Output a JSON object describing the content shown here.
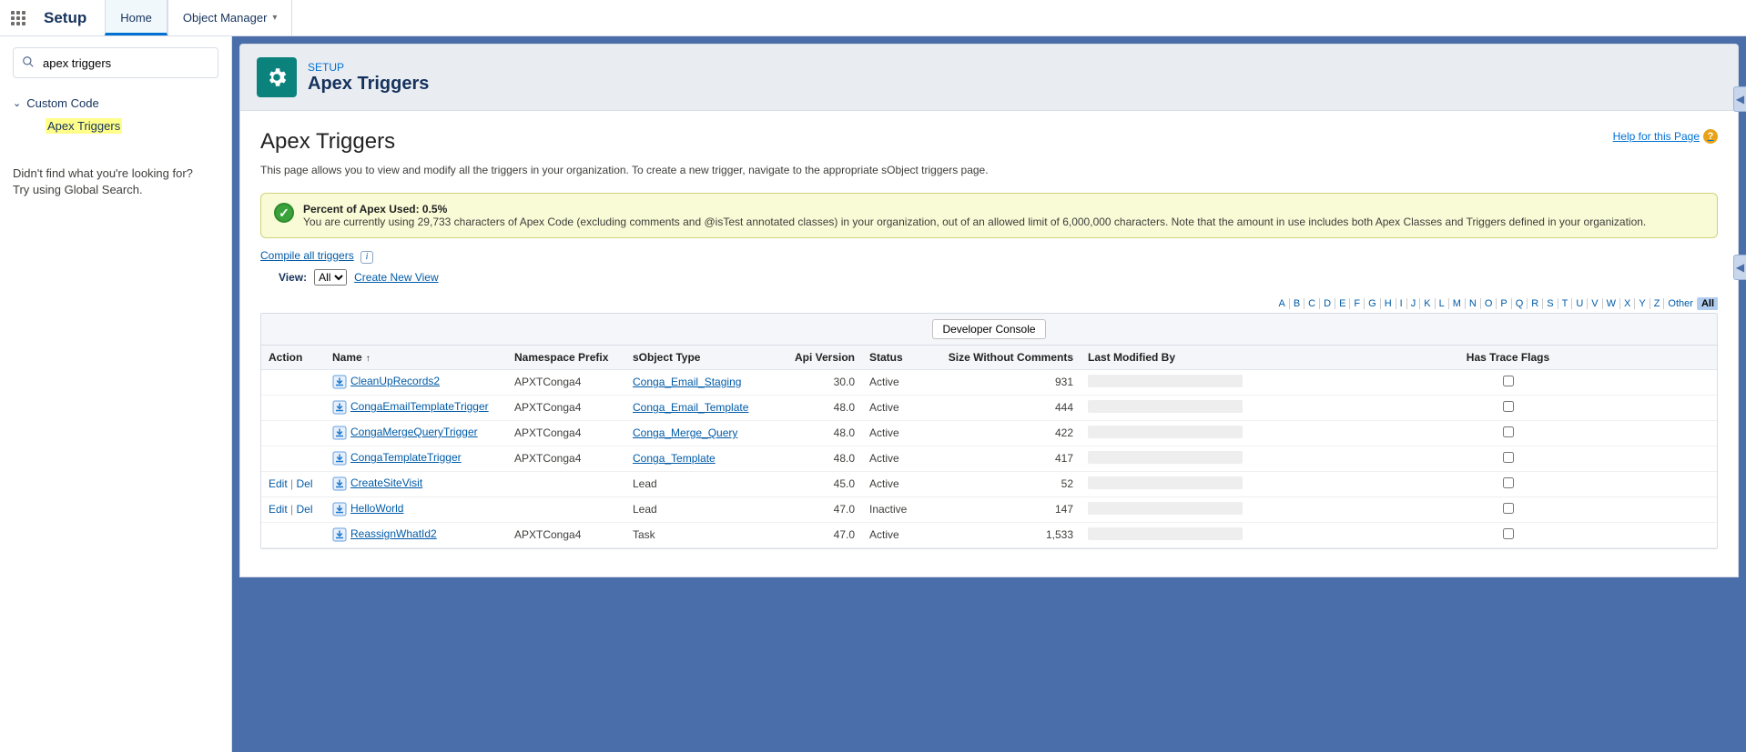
{
  "topbar": {
    "brand": "Setup",
    "tab_home": "Home",
    "tab_object_manager": "Object Manager"
  },
  "sidebar": {
    "search_value": "apex triggers",
    "tree_header": "Custom Code",
    "tree_item": "Apex Triggers",
    "note1": "Didn't find what you're looking for?",
    "note2": "Try using Global Search."
  },
  "header": {
    "breadcrumb": "SETUP",
    "title": "Apex Triggers"
  },
  "content": {
    "page_title": "Apex Triggers",
    "help_link": "Help for this Page",
    "description": "This page allows you to view and modify all the triggers in your organization. To create a new trigger, navigate to the appropriate sObject triggers page.",
    "info_title": "Percent of Apex Used: 0.5%",
    "info_body": "You are currently using 29,733 characters of Apex Code (excluding comments and @isTest annotated classes) in your organization, out of an allowed limit of 6,000,000 characters. Note that the amount in use includes both Apex Classes and Triggers defined in your organization.",
    "compile_link": "Compile all triggers",
    "view_label": "View:",
    "view_value": "All",
    "create_view": "Create New View",
    "dev_console": "Developer Console"
  },
  "alpha": {
    "letters": [
      "A",
      "B",
      "C",
      "D",
      "E",
      "F",
      "G",
      "H",
      "I",
      "J",
      "K",
      "L",
      "M",
      "N",
      "O",
      "P",
      "Q",
      "R",
      "S",
      "T",
      "U",
      "V",
      "W",
      "X",
      "Y",
      "Z"
    ],
    "other": "Other",
    "all": "All"
  },
  "table": {
    "headers": {
      "action": "Action",
      "name": "Name",
      "ns": "Namespace Prefix",
      "sobj": "sObject Type",
      "api": "Api Version",
      "status": "Status",
      "size": "Size Without Comments",
      "modby": "Last Modified By",
      "trace": "Has Trace Flags"
    },
    "edit": "Edit",
    "del": "Del",
    "rows": [
      {
        "action": "dl",
        "name": "CleanUpRecords2",
        "ns": "APXTConga4",
        "sobj": "Conga_Email_Staging",
        "sobj_link": true,
        "api": "30.0",
        "status": "Active",
        "size": "931"
      },
      {
        "action": "dl",
        "name": "CongaEmailTemplateTrigger",
        "ns": "APXTConga4",
        "sobj": "Conga_Email_Template",
        "sobj_link": true,
        "api": "48.0",
        "status": "Active",
        "size": "444"
      },
      {
        "action": "dl",
        "name": "CongaMergeQueryTrigger",
        "ns": "APXTConga4",
        "sobj": "Conga_Merge_Query",
        "sobj_link": true,
        "api": "48.0",
        "status": "Active",
        "size": "422"
      },
      {
        "action": "dl",
        "name": "CongaTemplateTrigger",
        "ns": "APXTConga4",
        "sobj": "Conga_Template",
        "sobj_link": true,
        "api": "48.0",
        "status": "Active",
        "size": "417"
      },
      {
        "action": "ed",
        "name": "CreateSiteVisit",
        "ns": "",
        "sobj": "Lead",
        "sobj_link": false,
        "api": "45.0",
        "status": "Active",
        "size": "52"
      },
      {
        "action": "ed",
        "name": "HelloWorld",
        "ns": "",
        "sobj": "Lead",
        "sobj_link": false,
        "api": "47.0",
        "status": "Inactive",
        "size": "147"
      },
      {
        "action": "dl",
        "name": "ReassignWhatId2",
        "ns": "APXTConga4",
        "sobj": "Task",
        "sobj_link": false,
        "api": "47.0",
        "status": "Active",
        "size": "1,533"
      }
    ]
  }
}
